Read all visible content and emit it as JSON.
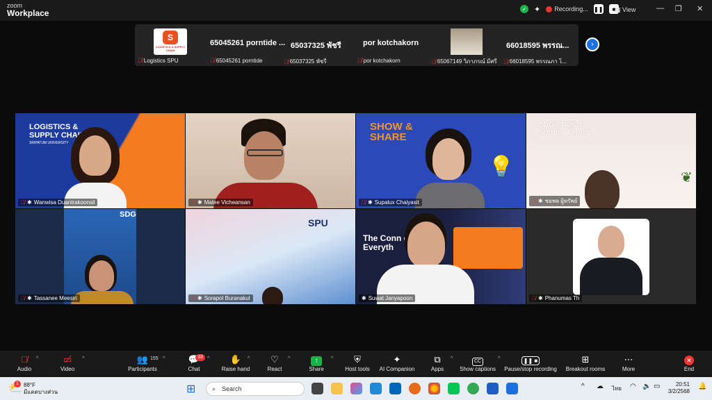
{
  "app": {
    "brand_line1": "zoom",
    "brand_line2": "Workplace",
    "recording_label": "Recording...",
    "view_label": "View"
  },
  "strip": {
    "names": [
      "65045261 porntide ...",
      "65037325 พัชรี",
      "por kotchakorn",
      "66018595 พรรณ..."
    ],
    "labels": [
      "Logistics SPU",
      "65045261 porntide",
      "65037325 พัชรี",
      "por kotchakorn",
      "65067149 วิภาภรณ์ มีศรี",
      "66018595 พรรณภา โ..."
    ],
    "logo_text": "LOGISTICS & SUPPLY CHAIN"
  },
  "tiles": [
    {
      "label": "Wanwisa Duantrakoonsil",
      "bg_text": "LOGISTICS & SUPPLY CHAIN",
      "sub": "SRIPATUM UNIVERSITY"
    },
    {
      "label": "Matee Vicheansan"
    },
    {
      "label": "Supalux Chaiyasit",
      "bg_text": "SHOW & SHARE"
    },
    {
      "label": "ชยพล ผู้ทรัพย์",
      "bg_text": "LOGISTICS & SUPPLY CHAIN"
    },
    {
      "label": "Tassanee Meesiri",
      "bg_text": "SDG"
    },
    {
      "label": "Sorapol Buranakul",
      "bg_text": "SPU"
    },
    {
      "label": "Suwat Janyapoon",
      "bg_text": "The Conn of Everyth"
    },
    {
      "label": "Phanumas Th"
    }
  ],
  "toolbar": {
    "audio": "Audio",
    "video": "Video",
    "participants": "Participants",
    "participants_count": "155",
    "chat": "Chat",
    "chat_badge": "33",
    "raise_hand": "Raise hand",
    "react": "React",
    "share": "Share",
    "host_tools": "Host tools",
    "ai_companion": "AI Companion",
    "apps": "Apps",
    "show_captions": "Show captions",
    "pause_rec": "Pause/stop recording",
    "breakout": "Breakout rooms",
    "more": "More",
    "end": "End"
  },
  "taskbar": {
    "weather_temp": "88°F",
    "weather_desc": "มีแดดบางส่วน",
    "search_placeholder": "Search",
    "lang": "ไทย",
    "time": "20:51",
    "date": "3/2/2568",
    "notif_badge": "1"
  },
  "colors": {
    "accent": "#1e6fe0",
    "danger": "#e33333",
    "green": "#19b34a"
  }
}
